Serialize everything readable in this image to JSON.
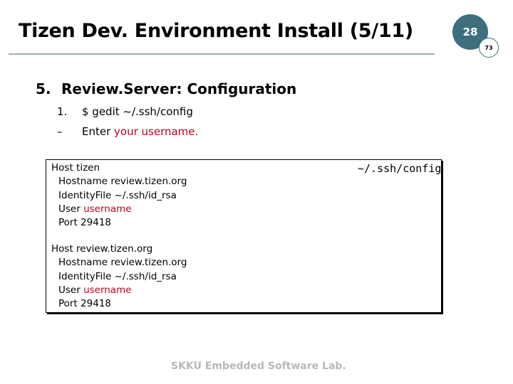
{
  "slide": {
    "title": "Tizen Dev. Environment Install (5/11)",
    "page_number": "28",
    "sub_page_number": "73"
  },
  "section": {
    "number": "5.",
    "heading": "Review.Server: Configuration"
  },
  "steps": [
    {
      "marker": "1.",
      "text": "$ gedit ~/.ssh/config",
      "highlight": ""
    },
    {
      "marker": "–",
      "text": "Enter ",
      "highlight": "your username."
    }
  ],
  "config_file": {
    "label": "~/.ssh/config",
    "hosts": [
      {
        "host": "Host tizen",
        "hostname": "Hostname review.tizen.org",
        "identity": "IdentityFile ~/.ssh/id_rsa",
        "user_prefix": "User ",
        "user_value": "username",
        "port": "Port 29418"
      },
      {
        "host": "Host review.tizen.org",
        "hostname": "Hostname review.tizen.org",
        "identity": "IdentityFile ~/.ssh/id_rsa",
        "user_prefix": "User ",
        "user_value": "username",
        "port": "Port 29418"
      }
    ]
  },
  "footer": "SKKU Embedded Software Lab.",
  "colors": {
    "badge": "#3f6f7e",
    "highlight": "#c0001a",
    "rule": "#9fb0b3",
    "footer": "#b8b8b8"
  }
}
